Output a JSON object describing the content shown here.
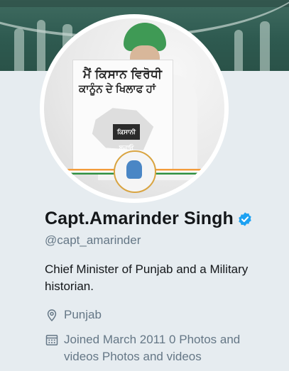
{
  "profile": {
    "name": "Capt.Amarinder Singh",
    "handle": "@capt_amarinder",
    "bio": "Chief Minister of Punjab and a Military historian.",
    "location": "Punjab",
    "joined_text": "Joined March 2011 0 Photos and videos Photos and videos",
    "verified": true
  },
  "avatar": {
    "placard_line1": "ਮੈਂ ਕਿਸਾਨ ਵਿਰੋਧੀ",
    "placard_line2": "ਕਾਨੂੰਨ ਦੇ ਖਿਲਾਫ ਹਾਂ",
    "placard_tag": "ਕਿਸਾਨੀ ਬਚਾਓ"
  },
  "colors": {
    "background": "#e6ecf0",
    "verified_blue": "#1da1f2",
    "muted_text": "#657786",
    "banner": "#2e5a50"
  },
  "icons": {
    "location": "location-pin-icon",
    "calendar": "calendar-icon",
    "verified": "verified-badge-icon"
  }
}
